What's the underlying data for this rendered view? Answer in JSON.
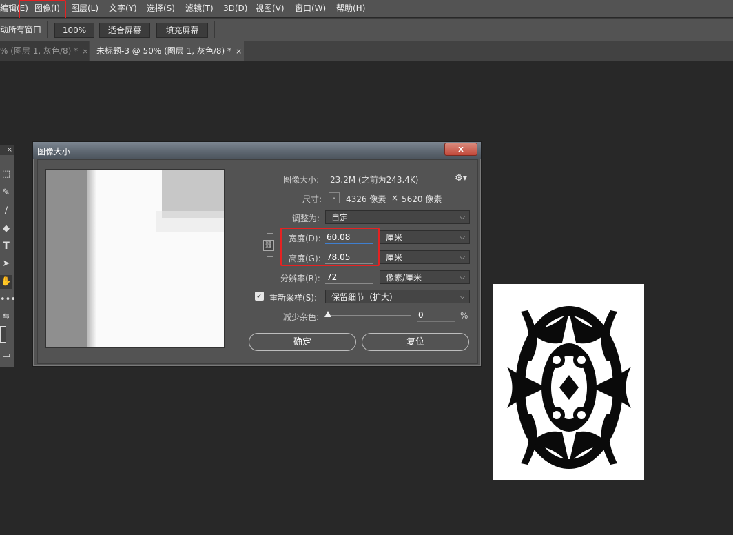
{
  "menubar": {
    "items": [
      "编辑(E)",
      "图像(I)",
      "图层(L)",
      "文字(Y)",
      "选择(S)",
      "滤镜(T)",
      "3D(D)",
      "视图(V)",
      "窗口(W)",
      "帮助(H)"
    ]
  },
  "options": {
    "all_windows": "动所有窗口",
    "zoom": "100%",
    "fit_screen": "适合屏幕",
    "fill_screen": "填充屏幕"
  },
  "tabs": [
    {
      "label": "% (图层 1, 灰色/8) *",
      "close": "×"
    },
    {
      "label": "未标题-3 @ 50% (图层 1, 灰色/8) *",
      "close": "×"
    }
  ],
  "dialog": {
    "title": "图像大小",
    "close": "x",
    "image_size_label": "图像大小:",
    "image_size_value": "23.2M (之前为243.4K)",
    "dimensions_label": "尺寸:",
    "dimensions_w": "4326 像素",
    "dimensions_x": "×",
    "dimensions_h": "5620 像素",
    "fit_to_label": "调整为:",
    "fit_to_value": "自定",
    "width_label": "宽度(D):",
    "width_value": "60.08",
    "width_unit": "厘米",
    "height_label": "高度(G):",
    "height_value": "78.05",
    "height_unit": "厘米",
    "resolution_label": "分辨率(R):",
    "resolution_value": "72",
    "resolution_unit": "像素/厘米",
    "resample_label": "重新采样(S):",
    "resample_value": "保留细节（扩大）",
    "resample_checked": true,
    "reduce_noise_label": "减少杂色:",
    "reduce_noise_value": "0",
    "reduce_noise_unit": "%",
    "ok_button": "确定",
    "reset_button": "复位"
  },
  "colors": {
    "highlight": "#e52222",
    "panel": "#535353",
    "workspace": "#282828"
  }
}
